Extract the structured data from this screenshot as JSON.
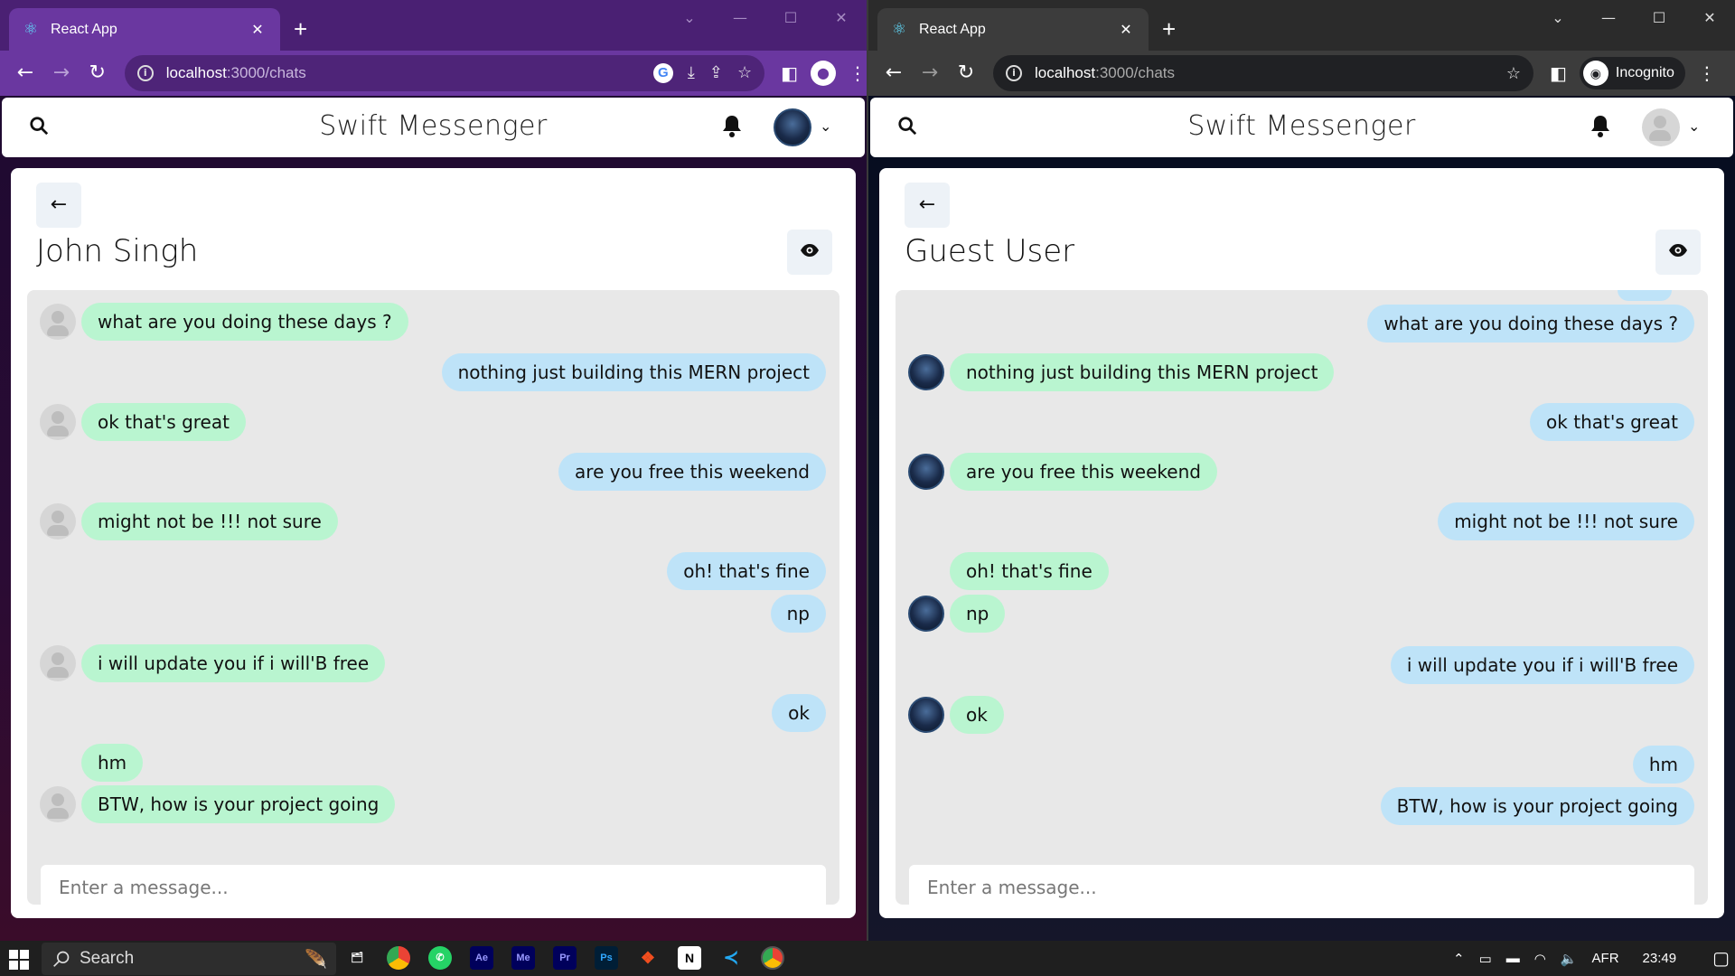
{
  "browser": {
    "tab_title": "React App",
    "url_host": "localhost",
    "url_path": ":3000/chats",
    "incognito_label": "Incognito"
  },
  "app": {
    "title": "Swift Messenger",
    "message_placeholder": "Enter a message..."
  },
  "left": {
    "chat_name": "John Singh",
    "messages": [
      {
        "text": "what are you doing these days ?",
        "side": "received",
        "avatar": "guest"
      },
      {
        "text": "nothing just building this MERN project",
        "side": "sent"
      },
      {
        "text": "ok that's great",
        "side": "received",
        "avatar": "guest"
      },
      {
        "text": "are you free this weekend",
        "side": "sent"
      },
      {
        "text": "might not be !!! not sure",
        "side": "received",
        "avatar": "guest"
      },
      {
        "text": "oh! that's fine",
        "side": "sent"
      },
      {
        "text": "np",
        "side": "sent"
      },
      {
        "text": "i will update you if i will'B free",
        "side": "received",
        "avatar": "guest"
      },
      {
        "text": "ok",
        "side": "sent"
      },
      {
        "text": "hm",
        "side": "received"
      },
      {
        "text": "BTW, how is your project going",
        "side": "received",
        "avatar": "guest"
      }
    ]
  },
  "right": {
    "chat_name": "Guest User",
    "messages": [
      {
        "text": "what are you doing these days ?",
        "side": "sent"
      },
      {
        "text": "nothing just building this MERN project",
        "side": "received",
        "avatar": "john"
      },
      {
        "text": "ok that's great",
        "side": "sent"
      },
      {
        "text": "are you free this weekend",
        "side": "received",
        "avatar": "john"
      },
      {
        "text": "might not be !!! not sure",
        "side": "sent"
      },
      {
        "text": "oh! that's fine",
        "side": "received"
      },
      {
        "text": "np",
        "side": "received",
        "avatar": "john"
      },
      {
        "text": "i will update you if i will'B free",
        "side": "sent"
      },
      {
        "text": "ok",
        "side": "received",
        "avatar": "john"
      },
      {
        "text": "hm",
        "side": "sent"
      },
      {
        "text": "BTW, how is your project going",
        "side": "sent"
      }
    ]
  },
  "taskbar": {
    "search_label": "Search",
    "language": "AFR",
    "time": "23:49",
    "apps": [
      "Ae",
      "Me",
      "Pr",
      "Ps"
    ]
  },
  "colors": {
    "sent_bubble": "#bee3f8",
    "received_bubble": "#b9f5d0",
    "chat_background": "#e8e8e8",
    "left_browser_frame": "#6a37a0",
    "right_browser_frame": "#3c3c3c"
  }
}
